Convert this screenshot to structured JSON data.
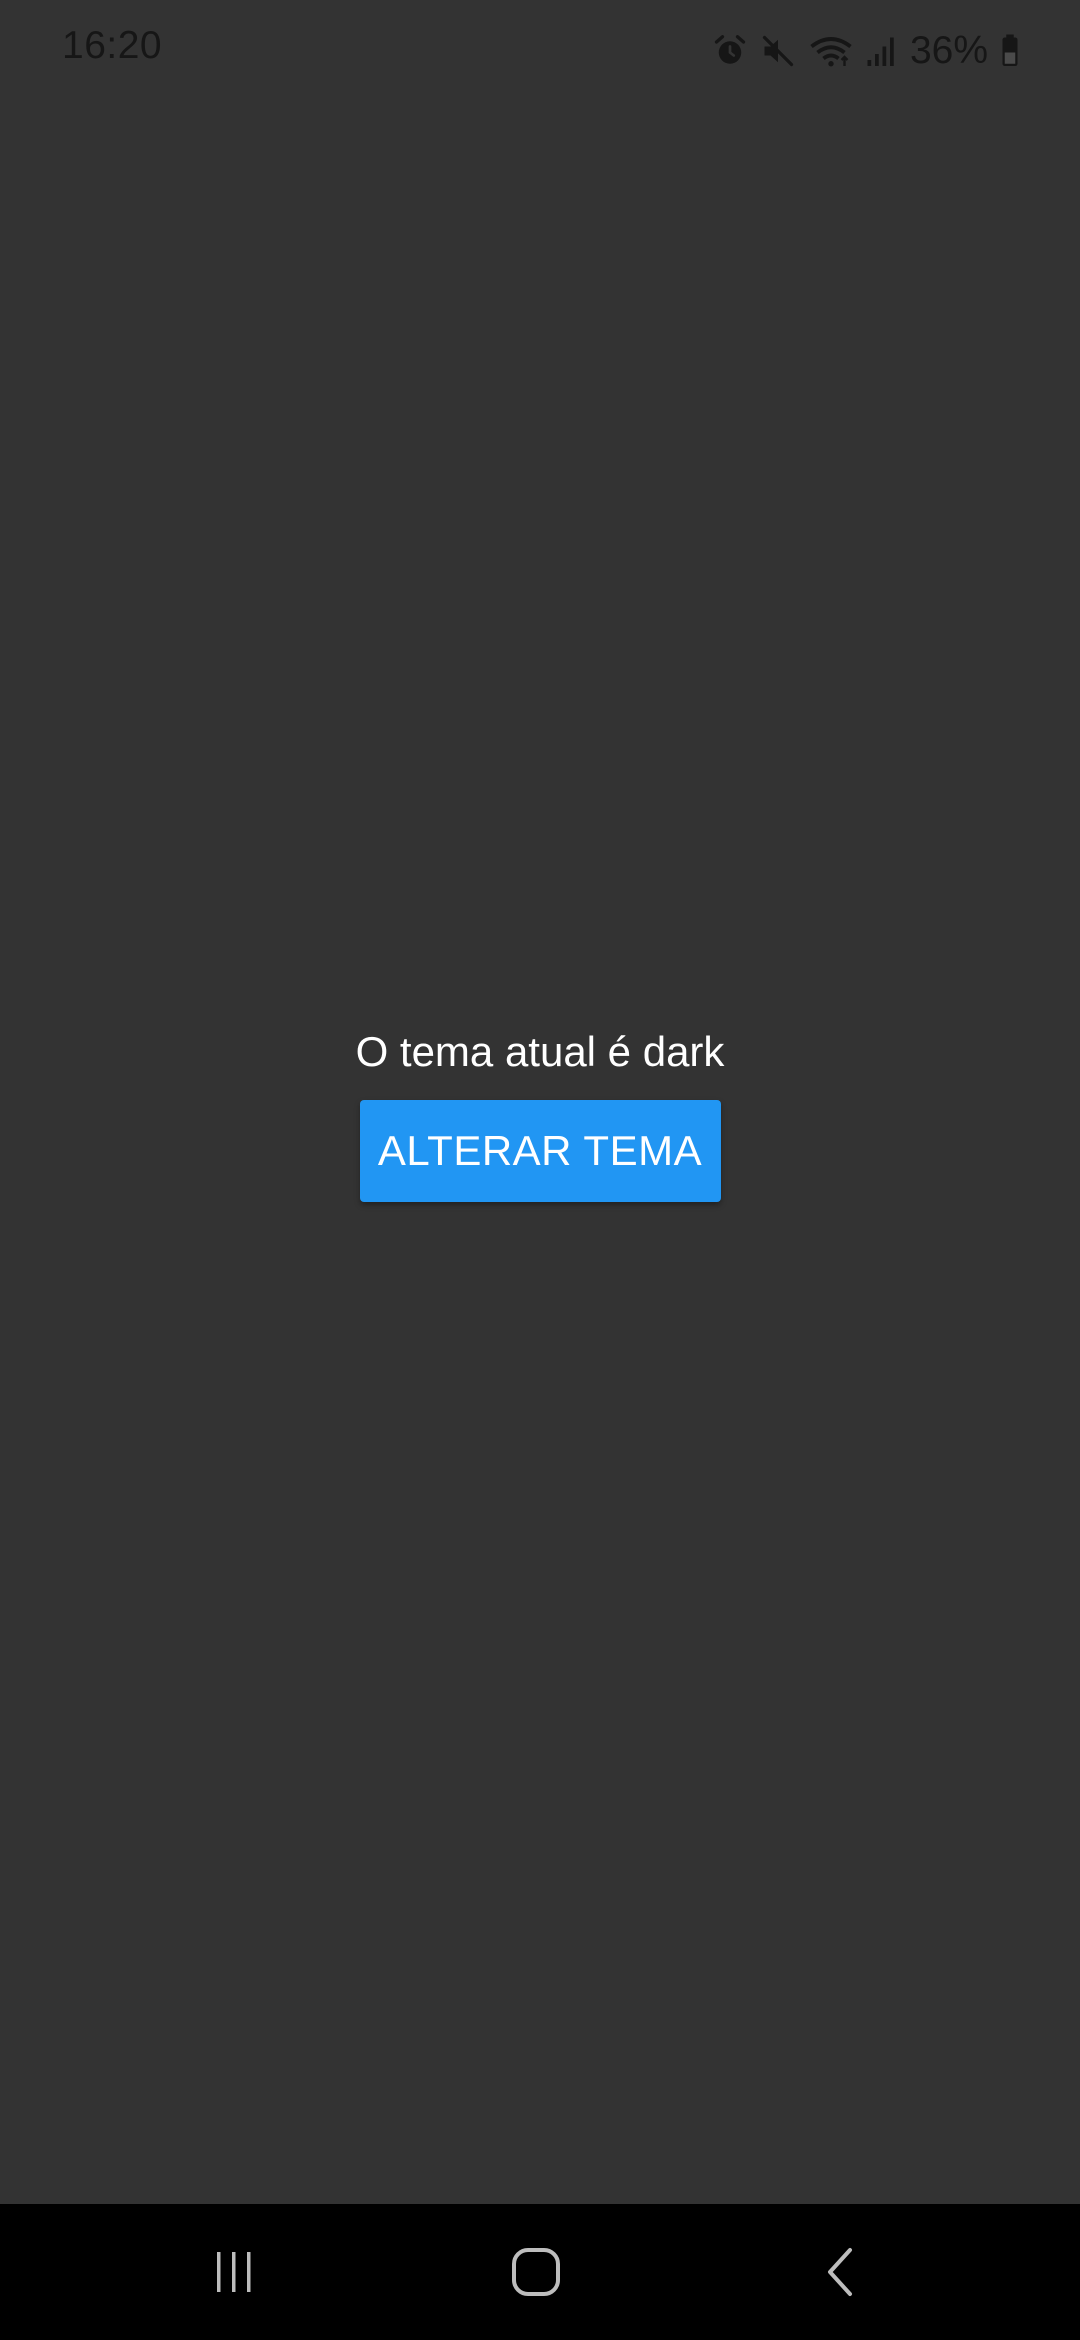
{
  "status_bar": {
    "time": "16:20",
    "battery_percent": "36%",
    "icons": [
      "alarm-icon",
      "mute-icon",
      "wifi-icon",
      "signal-icon",
      "battery-icon"
    ]
  },
  "main": {
    "theme_label": "O tema atual é dark",
    "toggle_button_label": "ALTERAR TEMA"
  },
  "nav_bar": {
    "buttons": [
      "recents-icon",
      "home-icon",
      "back-icon"
    ]
  },
  "colors": {
    "background": "#333333",
    "button": "#2196F3",
    "nav_bar": "#000000",
    "text": "#ffffff"
  }
}
